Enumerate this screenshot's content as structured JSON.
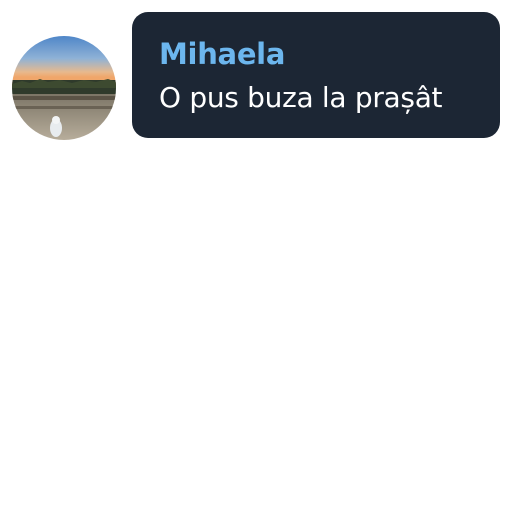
{
  "chat": {
    "avatar_icon": "user-avatar-landscape-photo",
    "sender_name": "Mihaela",
    "message_text": "O pus buza la prașât",
    "colors": {
      "bubble_background": "#1c2634",
      "sender_name": "#6cb6ee",
      "message_text": "#ffffff"
    }
  }
}
